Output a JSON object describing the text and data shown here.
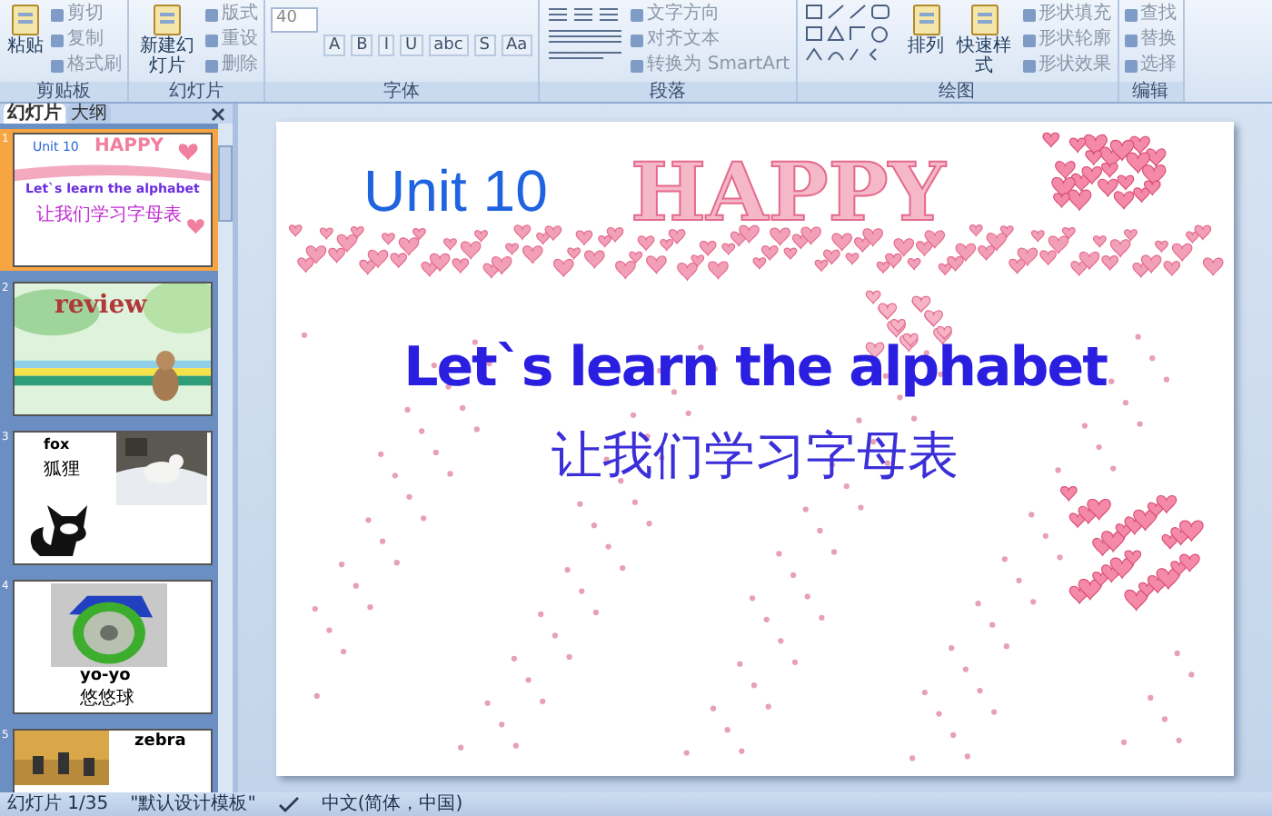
{
  "ribbon": {
    "groups": [
      {
        "name": "剪贴板",
        "items": [
          {
            "kind": "big",
            "label": "粘贴"
          },
          {
            "kind": "small",
            "label": "剪切"
          },
          {
            "kind": "small",
            "label": "复制"
          },
          {
            "kind": "small",
            "label": "格式刷"
          }
        ]
      },
      {
        "name": "幻灯片",
        "items": [
          {
            "kind": "big",
            "label": "新建幻灯片"
          },
          {
            "kind": "small",
            "label": "版式"
          },
          {
            "kind": "small",
            "label": "重设"
          },
          {
            "kind": "small",
            "label": "删除"
          }
        ]
      },
      {
        "name": "字体",
        "items": [
          {
            "kind": "field",
            "label": "40"
          },
          {
            "kind": "glyph",
            "label": "A"
          },
          {
            "kind": "glyph",
            "label": "B"
          },
          {
            "kind": "glyph",
            "label": "I"
          },
          {
            "kind": "glyph",
            "label": "U"
          },
          {
            "kind": "glyph",
            "label": "abc"
          },
          {
            "kind": "glyph",
            "label": "S"
          },
          {
            "kind": "glyph",
            "label": "Aa"
          }
        ]
      },
      {
        "name": "段落",
        "items": [
          {
            "kind": "lists"
          },
          {
            "kind": "small",
            "label": "文字方向"
          },
          {
            "kind": "small",
            "label": "对齐文本"
          },
          {
            "kind": "small",
            "label": "转换为 SmartArt"
          }
        ]
      },
      {
        "name": "绘图",
        "items": [
          {
            "kind": "shapes"
          },
          {
            "kind": "big",
            "label": "排列"
          },
          {
            "kind": "big",
            "label": "快速样式"
          },
          {
            "kind": "small",
            "label": "形状填充"
          },
          {
            "kind": "small",
            "label": "形状轮廓"
          },
          {
            "kind": "small",
            "label": "形状效果"
          }
        ]
      },
      {
        "name": "编辑",
        "items": [
          {
            "kind": "small",
            "label": "查找"
          },
          {
            "kind": "small",
            "label": "替换"
          },
          {
            "kind": "small",
            "label": "选择"
          }
        ]
      }
    ]
  },
  "pane": {
    "tabs": [
      {
        "label": "幻灯片",
        "selected": true
      },
      {
        "label": "大纲",
        "selected": false
      }
    ],
    "slides": [
      {
        "number": "1",
        "kind": "title",
        "selected": true,
        "texts": [
          "Unit 10",
          "HAPPY",
          "Let`s learn the alphabet",
          "让我们学习字母表"
        ]
      },
      {
        "number": "2",
        "kind": "review",
        "selected": false,
        "texts": [
          "review"
        ]
      },
      {
        "number": "3",
        "kind": "fox",
        "selected": false,
        "texts": [
          "fox",
          "狐狸"
        ]
      },
      {
        "number": "4",
        "kind": "yoyo",
        "selected": false,
        "texts": [
          "yo-yo",
          "悠悠球"
        ]
      },
      {
        "number": "5",
        "kind": "zebra",
        "selected": false,
        "texts": [
          "zebra"
        ]
      }
    ]
  },
  "slide": {
    "unit": "Unit 10",
    "art_title": "HAPPY",
    "title": "Let`s learn the alphabet",
    "subtitle": "让我们学习字母表"
  },
  "status_bar": {
    "slide_count": "幻灯片 1/35",
    "theme": "\"默认设计模板\"",
    "language": "中文(简体，中国)"
  }
}
